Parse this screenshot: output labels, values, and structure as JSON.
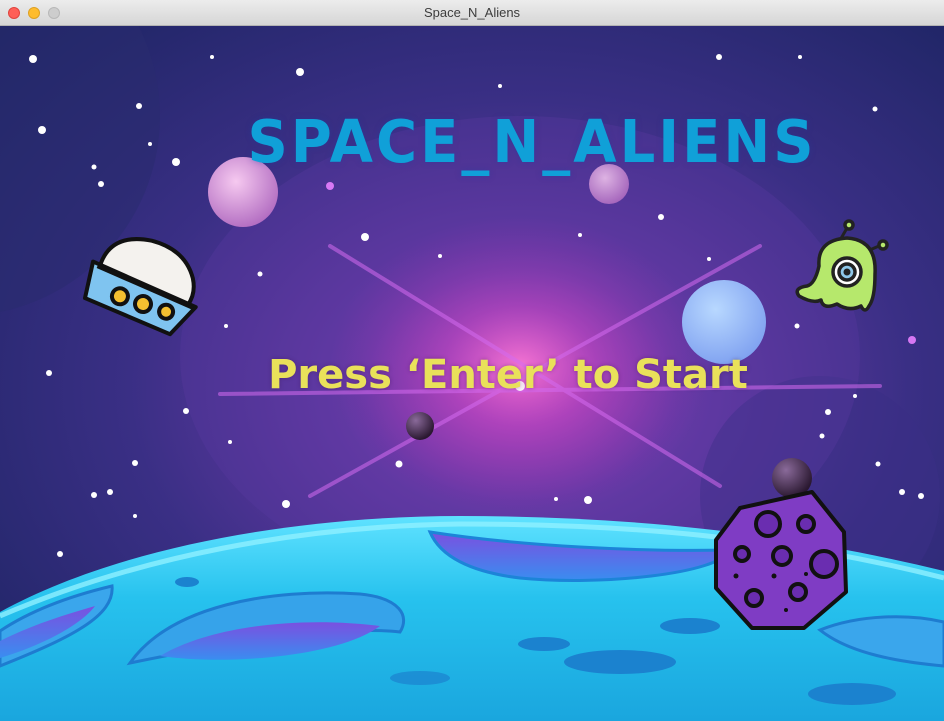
{
  "window": {
    "title": "Space_N_Aliens"
  },
  "game": {
    "title": "SPACE_N_ALIENS",
    "prompt": "Press ‘Enter’ to Start"
  },
  "colors": {
    "title": "#10a0d8",
    "prompt": "#e9e15a",
    "ground": "#2fc7f0",
    "alien": "#b6e86c",
    "asteroid": "#7f3cc4"
  },
  "icons": [
    "ufo-icon",
    "alien-icon",
    "asteroid-icon",
    "planet-icon"
  ]
}
